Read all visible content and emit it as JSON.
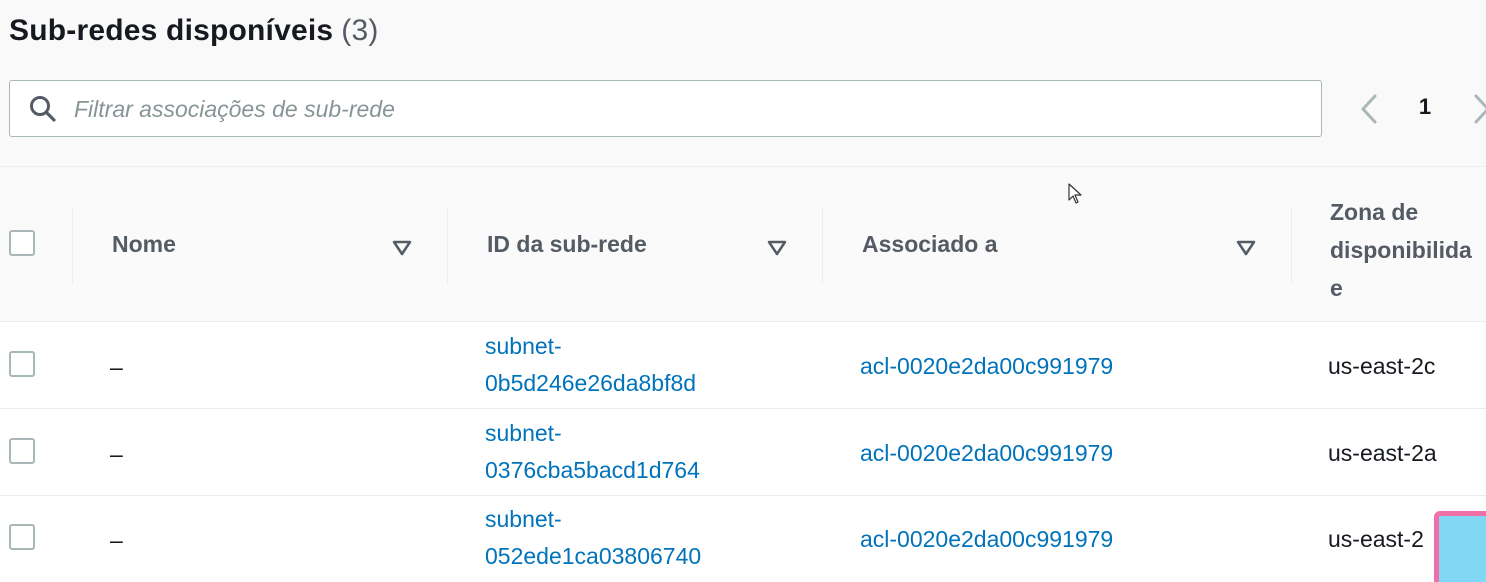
{
  "header": {
    "title": "Sub-redes disponíveis",
    "count": "(3)"
  },
  "search": {
    "placeholder": "Filtrar associações de sub-rede",
    "value": "",
    "icon": "search-icon"
  },
  "pagination": {
    "current_page": "1"
  },
  "table": {
    "columns": {
      "name": "Nome",
      "subnet_id": "ID da sub-rede",
      "associated": "Associado a",
      "zone_line1": "Zona de",
      "zone_line2": "disponibilida",
      "zone_line3": "e"
    },
    "rows": [
      {
        "name": "–",
        "subnet_id_line1": "subnet-",
        "subnet_id_line2": "0b5d246e26da8bf8d",
        "associated": "acl-0020e2da00c991979",
        "zone": "us-east-2c"
      },
      {
        "name": "–",
        "subnet_id_line1": "subnet-",
        "subnet_id_line2": "0376cba5bacd1d764",
        "associated": "acl-0020e2da00c991979",
        "zone": "us-east-2a"
      },
      {
        "name": "–",
        "subnet_id_line1": "subnet-",
        "subnet_id_line2": "052ede1ca03806740",
        "associated": "acl-0020e2da00c991979",
        "zone": "us-east-2"
      }
    ]
  },
  "colors": {
    "link": "#0073bb",
    "header_text": "#545b64",
    "title_text": "#16191f",
    "border": "#aab7b8"
  }
}
